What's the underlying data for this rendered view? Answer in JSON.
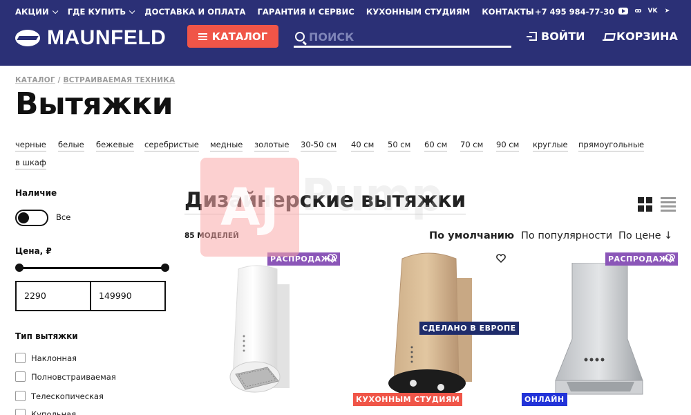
{
  "header": {
    "nav": [
      {
        "label": "АКЦИИ",
        "dropdown": true
      },
      {
        "label": "ГДЕ КУПИТЬ",
        "dropdown": true
      },
      {
        "label": "ДОСТАВКА И ОПЛАТА",
        "dropdown": false
      },
      {
        "label": "ГАРАНТИЯ И СЕРВИС",
        "dropdown": false
      },
      {
        "label": "КУХОННЫМ СТУДИЯМ",
        "dropdown": false
      },
      {
        "label": "КОНТАКТЫ",
        "dropdown": false
      }
    ],
    "phone": "+7 495 984-77-30",
    "socials": [
      "youtube-icon",
      "odnoklassniki-icon",
      "vk-icon",
      "telegram-icon"
    ],
    "social_glyphs": {
      "ok": "ꝏ",
      "vk": "VK",
      "tg": "➤"
    },
    "logo": "MAUNFELD",
    "catalog_label": "КАТАЛОГ",
    "search_placeholder": "ПОИСК",
    "login_label": "ВОЙТИ",
    "cart_label": "КОРЗИНА",
    "colors": {
      "bg": "#2b3076",
      "accent": "#f05548"
    }
  },
  "breadcrumb": {
    "items": [
      "КАТАЛОГ",
      "ВСТРАИВАЕМАЯ ТЕХНИКА"
    ],
    "separator": " / "
  },
  "page_title": "Вытяжки",
  "tags": [
    "черные",
    "белые",
    "бежевые",
    "серебристые",
    "медные",
    "золотые",
    "30-50 см",
    "40 см",
    "50 см",
    "60 см",
    "70 см",
    "90 см",
    "круглые",
    "прямоугольные",
    "в шкаф"
  ],
  "filters": {
    "availability": {
      "title": "Наличие",
      "toggle_label": "Все",
      "on": false
    },
    "price": {
      "title": "Цена, ₽",
      "min": "2290",
      "max": "149990"
    },
    "hood_type": {
      "title": "Тип вытяжки",
      "options": [
        "Наклонная",
        "Полновстраиваемая",
        "Телескопическая",
        "Купольная"
      ]
    }
  },
  "section": {
    "title": "Дизайнерские вытяжки",
    "count": "85 МОДЕЛЕЙ",
    "sort": [
      {
        "label": "По умолчанию",
        "active": true
      },
      {
        "label": "По популярности",
        "active": false
      },
      {
        "label": "По цене ↓",
        "active": false
      }
    ]
  },
  "products": [
    {
      "badges": [
        "РАСПРОДАЖА"
      ],
      "image": "white-cylinder-hood"
    },
    {
      "badges": [
        "СДЕЛАНО В ЕВРОПЕ",
        "КУХОННЫМ СТУДИЯМ"
      ],
      "image": "gold-cylinder-hood"
    },
    {
      "badges": [
        "РАСПРОДАЖА",
        "ОНЛАЙН"
      ],
      "image": "steel-dome-hood"
    }
  ],
  "watermark": {
    "mark": "AJ",
    "word": "Pump"
  }
}
